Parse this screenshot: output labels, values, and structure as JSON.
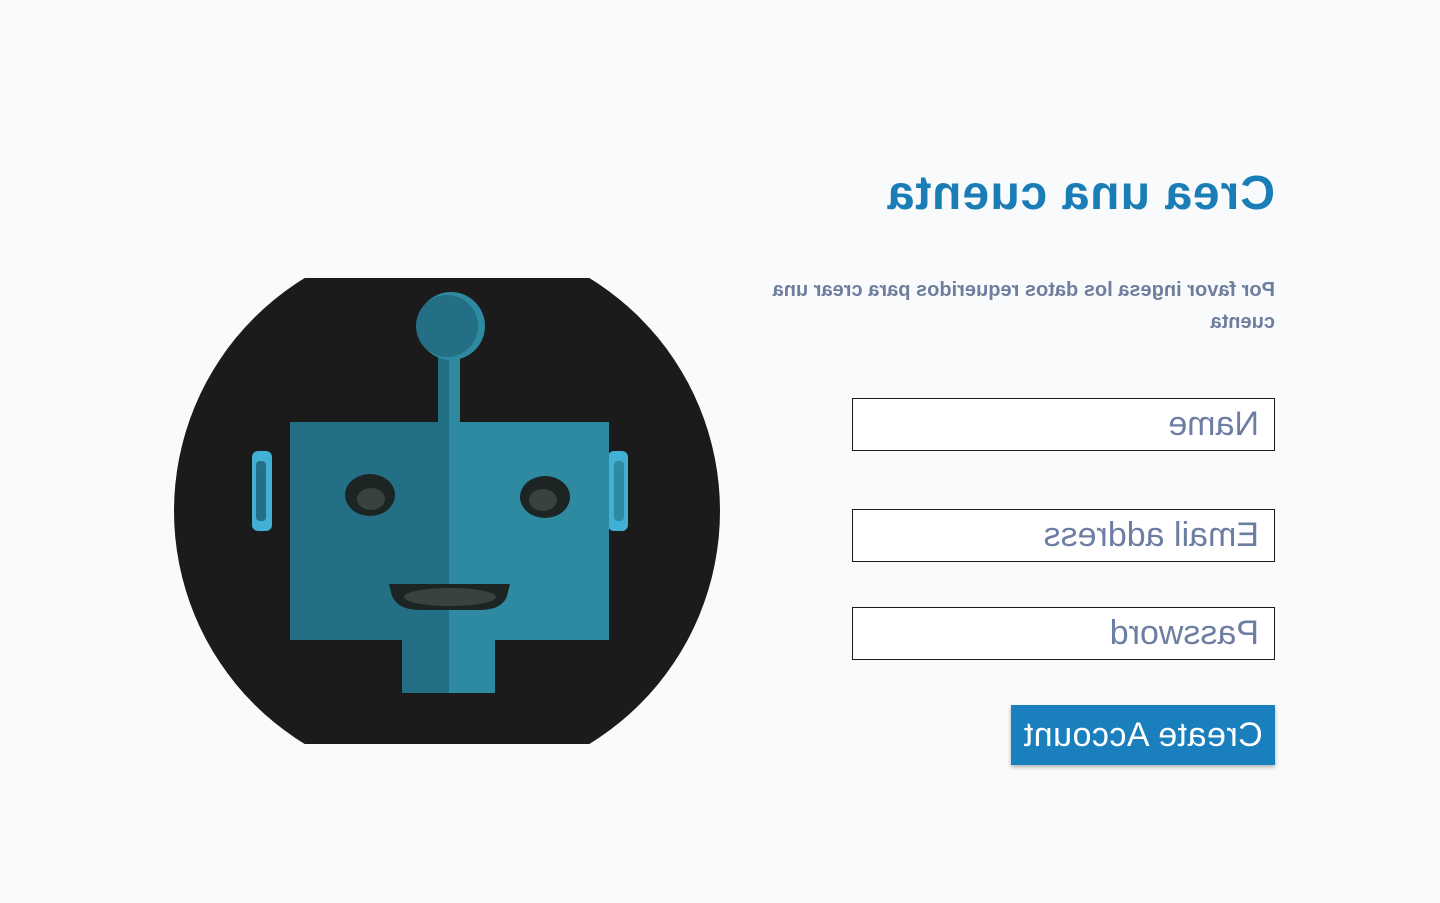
{
  "form": {
    "title": "Crea una cuenta",
    "subtitle": "Por favor ingesa los datos requeridos para crear una cuenta",
    "name_placeholder": "Name",
    "email_placeholder": "Email address",
    "password_placeholder": "Password",
    "submit_label": "Create Account"
  },
  "colors": {
    "background": "#f9fafc",
    "accent": "#1a80bd",
    "title": "#1a7db5",
    "subtitle": "#6e7e9c",
    "robot_dark": "#236f86",
    "robot_light": "#2d8aa1",
    "backdrop": "#1b1b1b"
  },
  "icons": {
    "illustration": "robot-head-icon"
  }
}
